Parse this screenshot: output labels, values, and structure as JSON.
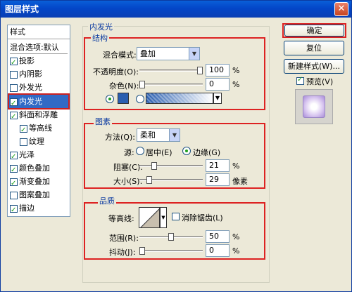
{
  "title": "图层样式",
  "close_symbol": "✕",
  "sidebar": {
    "header": "样式",
    "items": [
      {
        "label": "混合选项:默认",
        "checkbox": false
      },
      {
        "label": "投影",
        "checkbox": true,
        "checked": true
      },
      {
        "label": "内阴影",
        "checkbox": true,
        "checked": false
      },
      {
        "label": "外发光",
        "checkbox": true,
        "checked": false
      },
      {
        "label": "内发光",
        "checkbox": true,
        "checked": true,
        "selected": true
      },
      {
        "label": "斜面和浮雕",
        "checkbox": true,
        "checked": true
      },
      {
        "label": "等高线",
        "checkbox": true,
        "checked": true
      },
      {
        "label": "纹理",
        "checkbox": true,
        "checked": false
      },
      {
        "label": "光泽",
        "checkbox": true,
        "checked": true
      },
      {
        "label": "颜色叠加",
        "checkbox": true,
        "checked": true
      },
      {
        "label": "渐变叠加",
        "checkbox": true,
        "checked": true
      },
      {
        "label": "图案叠加",
        "checkbox": true,
        "checked": false
      },
      {
        "label": "描边",
        "checkbox": true,
        "checked": true
      }
    ]
  },
  "panel": {
    "title": "内发光",
    "structure": {
      "title": "结构",
      "blend_mode_label": "混合模式:",
      "blend_mode_value": "叠加",
      "opacity_label": "不透明度(O):",
      "opacity_value": "100",
      "opacity_unit": "%",
      "opacity_level": 1.0,
      "noise_label": "杂色(N):",
      "noise_value": "0",
      "noise_unit": "%",
      "noise_level": 0.0,
      "color_swatch": "#2b5fb0"
    },
    "elements": {
      "title": "图素",
      "method_label": "方法(Q):",
      "method_value": "柔和",
      "source_label": "源:",
      "center_label": "居中(E)",
      "edge_label": "边缘(G)",
      "choke_label": "阻塞(C):",
      "choke_value": "21",
      "choke_unit": "%",
      "choke_level": 0.21,
      "size_label": "大小(S):",
      "size_value": "29",
      "size_unit": "像素",
      "size_level": 0.116
    },
    "quality": {
      "title": "品质",
      "contour_label": "等高线:",
      "antialias_label": "消除锯齿(L)",
      "range_label": "范围(R):",
      "range_value": "50",
      "range_unit": "%",
      "range_level": 0.5,
      "jitter_label": "抖动(J):",
      "jitter_value": "0",
      "jitter_unit": "%",
      "jitter_level": 0.0
    }
  },
  "buttons": {
    "ok": "确定",
    "reset": "复位",
    "new_style": "新建样式(W)...",
    "preview": "预览(V)"
  },
  "colors": {
    "accent_red": "#d22222",
    "selection_blue": "#316ac5",
    "title_blue": "#0346c8"
  }
}
